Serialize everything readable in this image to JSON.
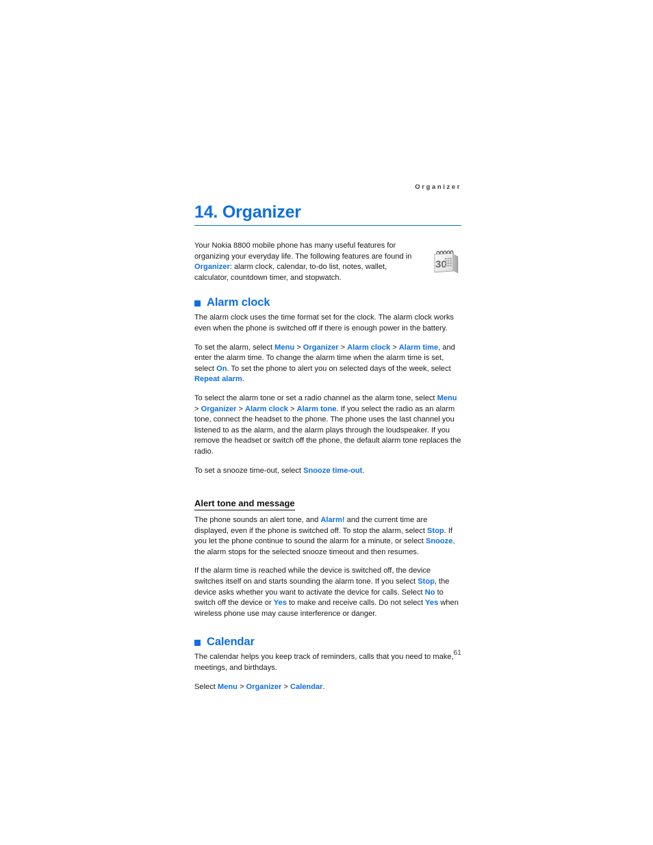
{
  "page": {
    "running_head": "Organizer",
    "chapter_title": "14. Organizer",
    "page_number": "61",
    "accent_color": "#0f6fe0",
    "text_color": "#171717"
  },
  "intro": {
    "text_1": "Your Nokia 8800 mobile phone has many useful features for organizing your everyday life. The following features are found in ",
    "link_organizer": "Organizer",
    "text_2": ": alarm clock, calendar, to-do list, notes, wallet, calculator, countdown timer, and stopwatch.",
    "icon_name": "desk-calendar-icon",
    "icon_day": "30"
  },
  "alarm_clock": {
    "heading": "Alarm clock",
    "para_1": "The alarm clock uses the time format set for the clock. The alarm clock works even when the phone is switched off if there is enough power in the battery.",
    "para_2": {
      "t1": "To set the alarm, select ",
      "l1": "Menu",
      "s1": " > ",
      "l2": "Organizer",
      "s2": " > ",
      "l3": "Alarm clock",
      "s3": " > ",
      "l4": "Alarm time",
      "t2": ", and enter the alarm time. To change the alarm time when the alarm time is set, select ",
      "l5": "On",
      "t3": ". To set the phone to alert you on selected days of the week, select ",
      "l6": "Repeat alarm",
      "t4": "."
    },
    "para_3": {
      "t1": "To select the alarm tone or set a radio channel as the alarm tone, select ",
      "l1": "Menu",
      "s1": " > ",
      "l2": "Organizer",
      "s2": " > ",
      "l3": "Alarm clock",
      "s3": " > ",
      "l4": "Alarm tone",
      "t2": ". If you select the radio as an alarm tone, connect the headset to the phone. The phone uses the last channel you listened to as the alarm, and the alarm plays through the loudspeaker. If you remove the headset or switch off the phone, the default alarm tone replaces the radio."
    },
    "para_4": {
      "t1": "To set a snooze time-out, select ",
      "l1": "Snooze time-out",
      "t2": "."
    }
  },
  "alert_tone": {
    "heading": "Alert tone and message",
    "para_1": {
      "t1": "The phone sounds an alert tone, and ",
      "l1": "Alarm!",
      "t2": " and the current time are displayed, even if the phone is switched off. To stop the alarm, select ",
      "l2": "Stop",
      "t3": ". If you let the phone continue to sound the alarm for a minute, or select ",
      "l3": "Snooze",
      "t4": ", the alarm stops for the selected snooze timeout and then resumes."
    },
    "para_2": {
      "t1": "If the alarm time is reached while the device is switched off, the device switches itself on and starts sounding the alarm tone. If you select ",
      "l1": "Stop",
      "t2": ", the device asks whether you want to activate the device for calls. Select ",
      "l2": "No",
      "t3": " to switch off the device or ",
      "l3": "Yes",
      "t4": " to make and receive calls. Do not select ",
      "l4": "Yes",
      "t5": " when wireless phone use may cause interference or danger."
    }
  },
  "calendar": {
    "heading": "Calendar",
    "para_1": "The calendar helps you keep track of reminders, calls that you need to make, meetings, and birthdays.",
    "para_2": {
      "t1": "Select ",
      "l1": "Menu",
      "s1": " > ",
      "l2": "Organizer",
      "s2": " > ",
      "l3": "Calendar",
      "t2": "."
    }
  }
}
